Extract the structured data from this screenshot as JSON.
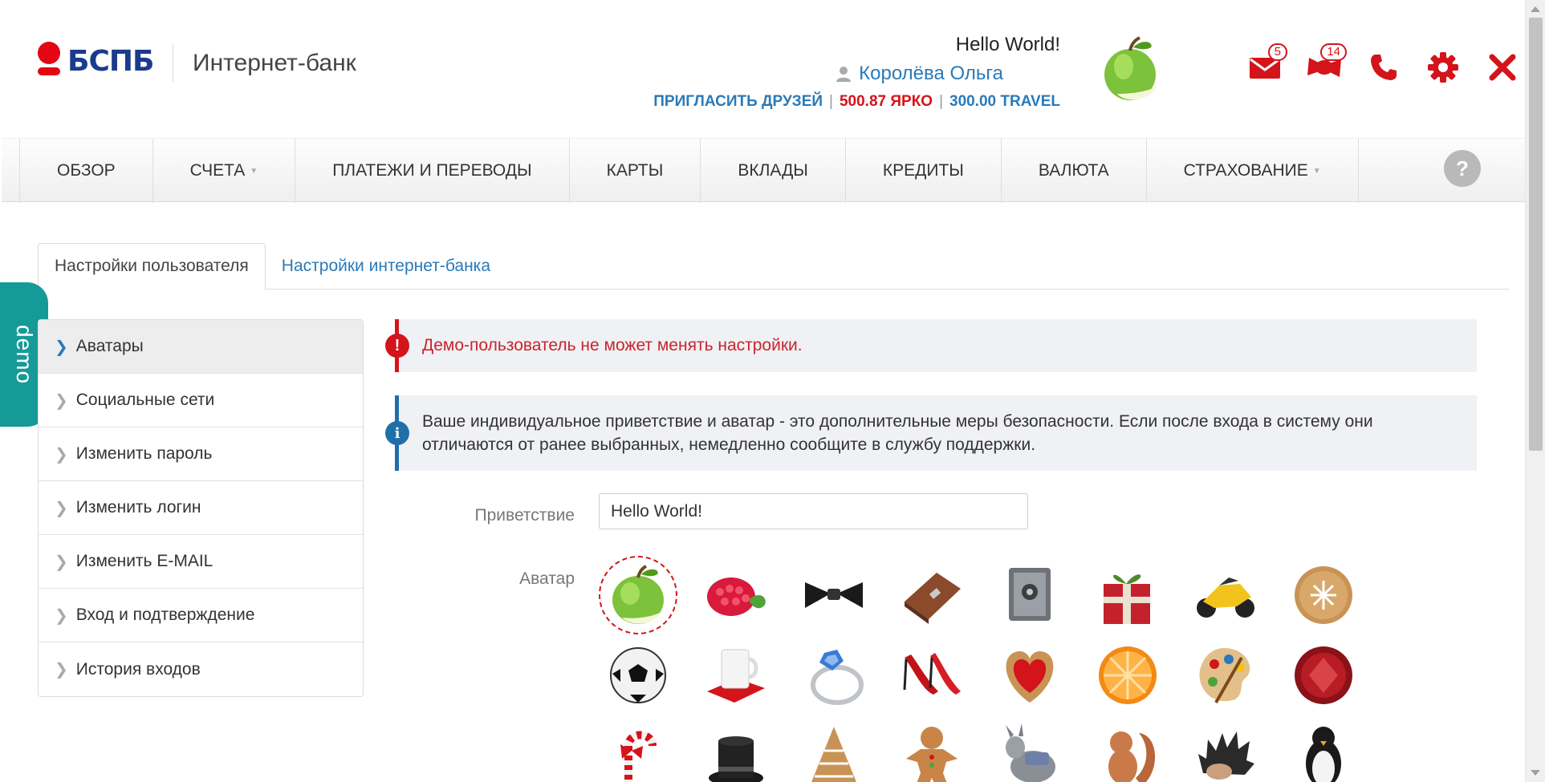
{
  "bank": {
    "logo_text": "БСПБ",
    "app_title": "Интернет-банк"
  },
  "user": {
    "greeting": "Hello World!",
    "name": "Королёва Ольга",
    "invite_link": "ПРИГЛАСИТЬ ДРУЗЕЙ",
    "yarko_balance": "500.87 ЯРКО",
    "travel_balance": "300.00 TRAVEL"
  },
  "header_icons": {
    "mail_count": "5",
    "gift_count": "14"
  },
  "nav": {
    "items": [
      {
        "label": "ОБЗОР",
        "dropdown": false
      },
      {
        "label": "СЧЕТА",
        "dropdown": true
      },
      {
        "label": "ПЛАТЕЖИ И ПЕРЕВОДЫ",
        "dropdown": false
      },
      {
        "label": "КАРТЫ",
        "dropdown": false
      },
      {
        "label": "ВКЛАДЫ",
        "dropdown": false
      },
      {
        "label": "КРЕДИТЫ",
        "dropdown": false
      },
      {
        "label": "ВАЛЮТА",
        "dropdown": false
      },
      {
        "label": "СТРАХОВАНИЕ",
        "dropdown": true
      }
    ],
    "help_label": "?"
  },
  "tabs": [
    {
      "label": "Настройки пользователя",
      "active": true
    },
    {
      "label": "Настройки интернет-банка",
      "active": false
    }
  ],
  "demo_label": "demo",
  "sidebar": {
    "items": [
      {
        "label": "Аватары",
        "active": true
      },
      {
        "label": "Социальные сети",
        "active": false
      },
      {
        "label": "Изменить пароль",
        "active": false
      },
      {
        "label": "Изменить логин",
        "active": false
      },
      {
        "label": "Изменить E-MAIL",
        "active": false
      },
      {
        "label": "Вход и подтверждение",
        "active": false
      },
      {
        "label": "История входов",
        "active": false
      }
    ]
  },
  "alerts": {
    "error": "Демо-пользователь не может менять настройки.",
    "info": "Ваше индивидуальное приветствие и аватар - это дополнительные меры безопасности. Если после входа в систему они отличаются от ранее выбранных, немедленно сообщите в службу поддержки."
  },
  "form": {
    "greeting_label": "Приветствие",
    "greeting_value": "Hello World!",
    "avatar_label": "Аватар"
  },
  "avatars": {
    "selected": "apple",
    "items": [
      "apple",
      "raspberry",
      "bow-tie",
      "briefcase",
      "safe",
      "gift",
      "motorcycle",
      "cookie",
      "soccer-ball",
      "mug",
      "ring",
      "high-heels",
      "heart-cookie",
      "orange",
      "palette",
      "gem",
      "candy-cane",
      "top-hat",
      "christmas-tree",
      "gingerbread-man",
      "donkey",
      "squirrel",
      "hedgehog",
      "penguin"
    ]
  },
  "colors": {
    "brand_red": "#e30613",
    "brand_blue": "#1a3c8c",
    "link_blue": "#2a7ab8",
    "demo_teal": "#169a97"
  }
}
